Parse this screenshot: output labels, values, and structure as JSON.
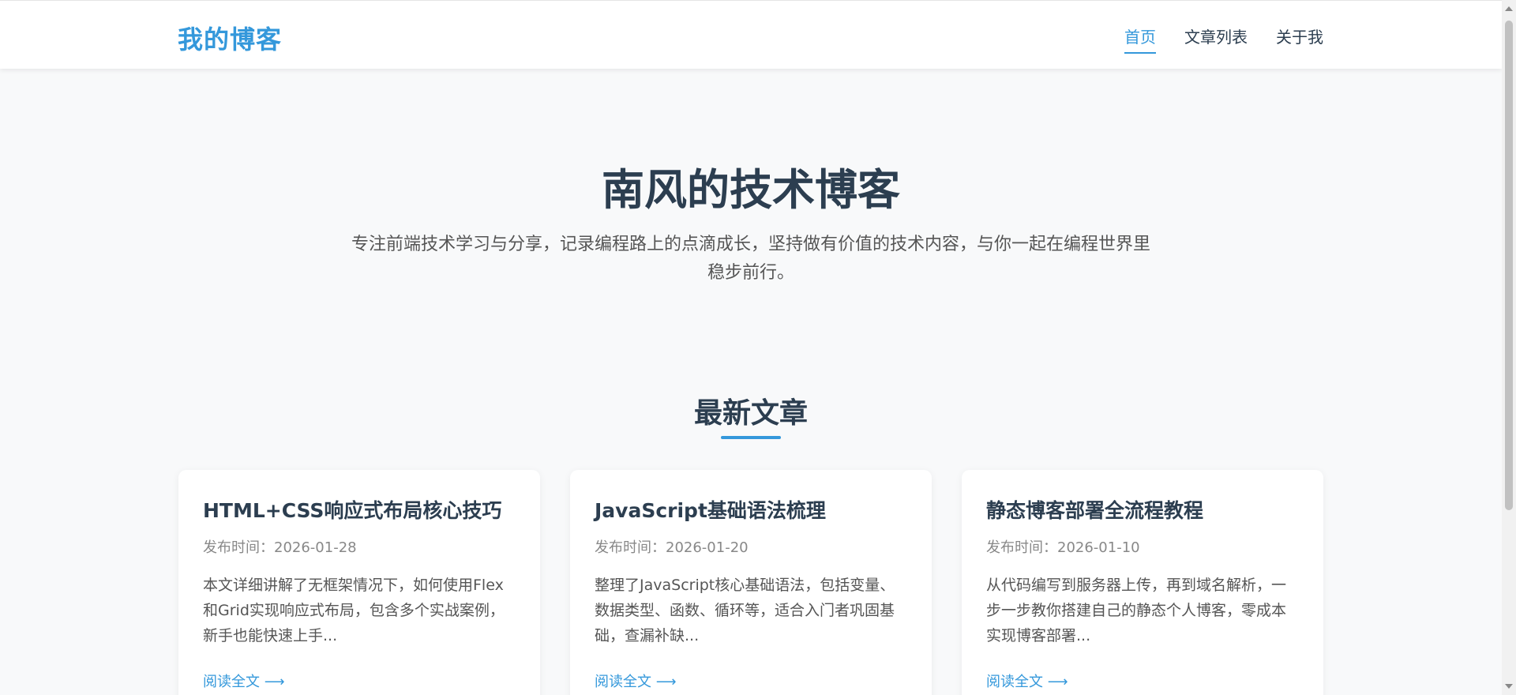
{
  "header": {
    "logo": "我的博客",
    "nav": [
      {
        "label": "首页",
        "active": true
      },
      {
        "label": "文章列表",
        "active": false
      },
      {
        "label": "关于我",
        "active": false
      }
    ]
  },
  "hero": {
    "title": "南风的技术博客",
    "description": "专注前端技术学习与分享，记录编程路上的点滴成长，坚持做有价值的技术内容，与你一起在编程世界里稳步前行。"
  },
  "section": {
    "title": "最新文章"
  },
  "posts": [
    {
      "title": "HTML+CSS响应式布局核心技巧",
      "date": "发布时间：2026-01-28",
      "excerpt": "本文详细讲解了无框架情况下，如何使用Flex和Grid实现响应式布局，包含多个实战案例，新手也能快速上手...",
      "link": "阅读全文 ⟶"
    },
    {
      "title": "JavaScript基础语法梳理",
      "date": "发布时间：2026-01-20",
      "excerpt": "整理了JavaScript核心基础语法，包括变量、数据类型、函数、循环等，适合入门者巩固基础，查漏补缺...",
      "link": "阅读全文 ⟶"
    },
    {
      "title": "静态博客部署全流程教程",
      "date": "发布时间：2026-01-10",
      "excerpt": "从代码编写到服务器上传，再到域名解析，一步一步教你搭建自己的静态个人博客，零成本实现博客部署...",
      "link": "阅读全文 ⟶"
    }
  ],
  "colors": {
    "accent": "#3498db",
    "heading": "#2c3e50",
    "background": "#f8f9fa"
  }
}
